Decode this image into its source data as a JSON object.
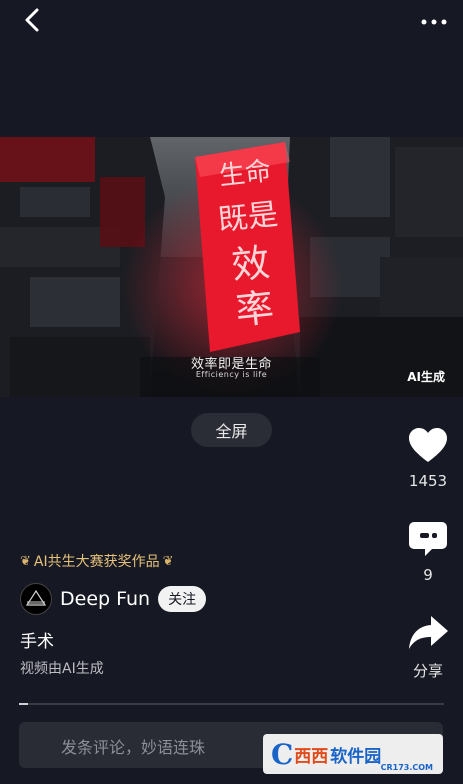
{
  "top_bar": {
    "back_icon": "chevron-left-icon",
    "more_icon": "more-horizontal-icon"
  },
  "video": {
    "sign_text": "生命既是效率",
    "caption_cn": "效率即是生命",
    "caption_en": "Efficiency is life",
    "ai_tag": "AI生成"
  },
  "fullscreen_label": "全屏",
  "actions": {
    "like_count": "1453",
    "comment_count": "9",
    "share_label": "分享"
  },
  "info": {
    "award_text": "AI共生大赛获奖作品",
    "author_name": "Deep Fun",
    "follow_label": "关注",
    "title": "手术",
    "subtitle": "视频由AI生成"
  },
  "progress": 0.005,
  "comment_input": {
    "placeholder": "发条评论，妙语连珠"
  },
  "watermark": {
    "logo_letter": "C",
    "brand_a": "西西",
    "brand_b": "软件园",
    "url": "CR173.COM"
  },
  "colors": {
    "background": "#161823",
    "sign_red": "#e8192c",
    "award_gold": "#e6c27a"
  }
}
